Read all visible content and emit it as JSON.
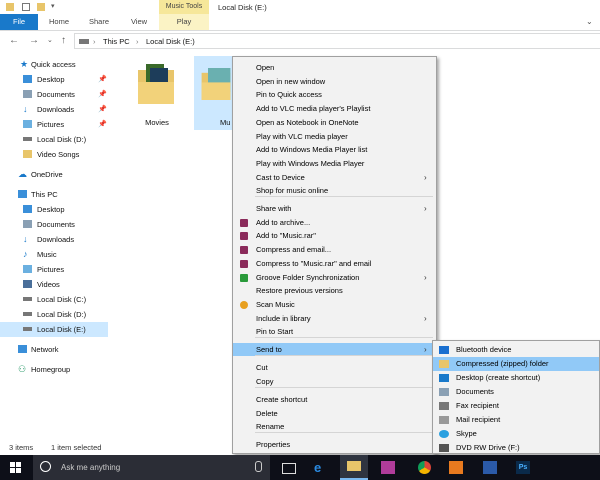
{
  "window": {
    "title": "Local Disk (E:)"
  },
  "ribbon": {
    "tabs": [
      "File",
      "Home",
      "Share",
      "View",
      "Play"
    ],
    "contextual_group": "Music Tools"
  },
  "address": {
    "crumbs": [
      "This PC",
      "Local Disk (E:)"
    ]
  },
  "nav": {
    "quick_access": "Quick access",
    "qa_items": [
      "Desktop",
      "Documents",
      "Downloads",
      "Pictures",
      "Local Disk (D:)",
      "Video Songs"
    ],
    "onedrive": "OneDrive",
    "this_pc": "This PC",
    "pc_items": [
      "Desktop",
      "Documents",
      "Downloads",
      "Music",
      "Pictures",
      "Videos",
      "Local Disk (C:)",
      "Local Disk (D:)",
      "Local Disk (E:)"
    ],
    "network": "Network",
    "homegroup": "Homegroup"
  },
  "content": {
    "folders": [
      "Movies",
      "Mu"
    ]
  },
  "status": {
    "count": "3 items",
    "selected": "1 item selected"
  },
  "context_menu": {
    "group1": [
      "Open",
      "Open in new window",
      "Pin to Quick access",
      "Add to VLC media player's Playlist",
      "Open as Notebook in OneNote",
      "Play with VLC media player",
      "Add to Windows Media Player list",
      "Play with Windows Media Player",
      "Cast to Device",
      "Shop for music online"
    ],
    "group2": [
      "Share with",
      "Add to archive...",
      "Add to \"Music.rar\"",
      "Compress and email...",
      "Compress to \"Music.rar\" and email",
      "Groove Folder Synchronization",
      "Restore previous versions",
      "Scan Music",
      "Include in library",
      "Pin to Start"
    ],
    "group3": [
      "Send to"
    ],
    "group4": [
      "Cut",
      "Copy"
    ],
    "group5": [
      "Create shortcut",
      "Delete",
      "Rename"
    ],
    "group6": [
      "Properties"
    ]
  },
  "send_to_menu": {
    "items": [
      "Bluetooth device",
      "Compressed (zipped) folder",
      "Desktop (create shortcut)",
      "Documents",
      "Fax recipient",
      "Mail recipient",
      "Skype",
      "DVD RW Drive (F:)"
    ]
  },
  "taskbar": {
    "search_placeholder": "Ask me anything",
    "ps_label": "Ps"
  },
  "colors": {
    "accent": "#1979ca",
    "highlight": "#91c9f7",
    "selection": "#cce8ff",
    "taskbar": "#0d0f18"
  }
}
